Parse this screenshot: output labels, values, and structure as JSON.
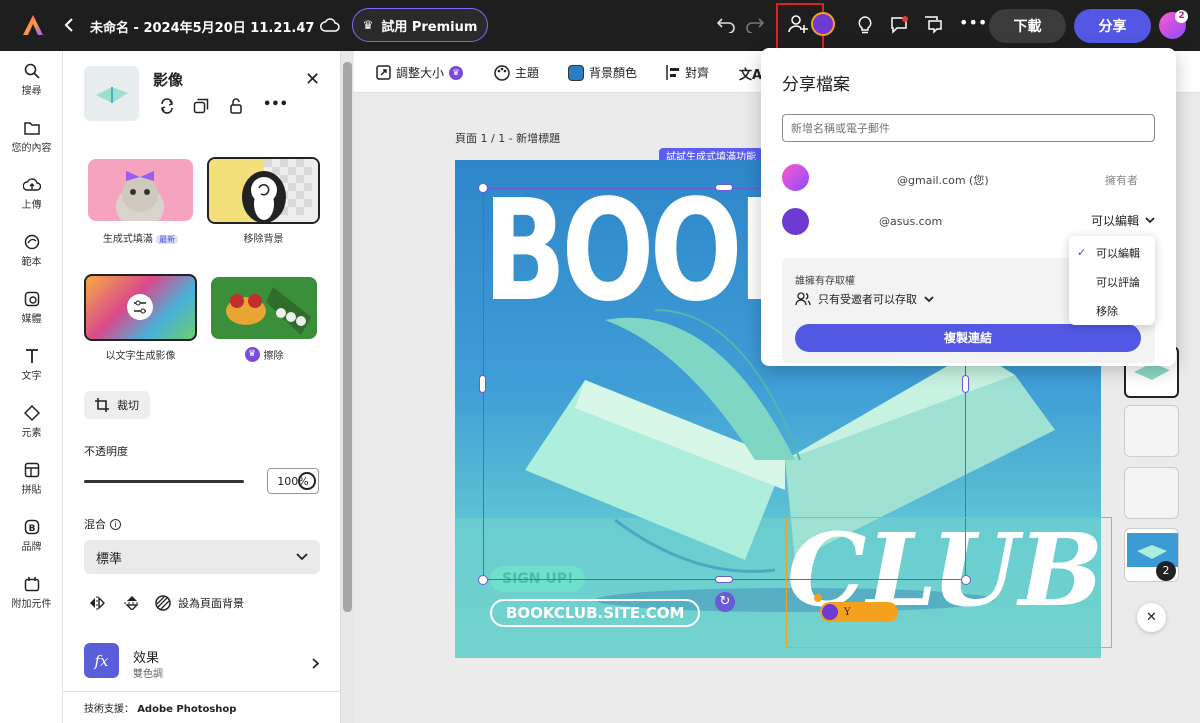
{
  "topbar": {
    "title": "未命名 - 2024年5月20日 11.21.47",
    "premium_label": "試用 Premium",
    "download_label": "下載",
    "share_label": "分享",
    "avatar_badge": "2"
  },
  "rail": {
    "items": [
      {
        "label": "搜尋",
        "icon": "search-icon"
      },
      {
        "label": "您的內容",
        "icon": "folder-icon"
      },
      {
        "label": "上傳",
        "icon": "upload-icon"
      },
      {
        "label": "範本",
        "icon": "template-icon"
      },
      {
        "label": "媒體",
        "icon": "media-icon"
      },
      {
        "label": "文字",
        "icon": "text-icon"
      },
      {
        "label": "元素",
        "icon": "elements-icon"
      },
      {
        "label": "拼貼",
        "icon": "grid-icon"
      },
      {
        "label": "品牌",
        "icon": "brand-icon"
      },
      {
        "label": "附加元件",
        "icon": "addons-icon"
      }
    ]
  },
  "panel": {
    "title": "影像",
    "cards": [
      {
        "label": "生成式填滿",
        "badge": "最新"
      },
      {
        "label": "移除背景"
      },
      {
        "label": "以文字生成影像"
      },
      {
        "label": "擦除"
      }
    ],
    "crop_label": "裁切",
    "opacity_label": "不透明度",
    "opacity_value": "100%",
    "opacity_fraction": 1.0,
    "blend_label": "混合",
    "blend_value": "標準",
    "set_bg_label": "設為頁面背景",
    "effects_title": "效果",
    "effects_sub": "雙色調",
    "footer_prefix": "技術支援：",
    "footer_brand": "Adobe Photoshop"
  },
  "toolbar": {
    "resize": "調整大小",
    "theme": "主題",
    "bg_color": "背景顏色",
    "align": "對齊",
    "bg_color_swatch": "#2a7fc4"
  },
  "canvas": {
    "page_label": "頁面 1 / 1 - 新增標題",
    "gen_fill_tip": "試試生成式填滿功能",
    "poster_title": "BOOK",
    "poster_club": "CLUB",
    "signup": "SIGN UP!",
    "site": "BOOKCLUB.SITE.COM",
    "cursor_label": "Y"
  },
  "share": {
    "title": "分享檔案",
    "input_placeholder": "新增名稱或電子郵件",
    "people": [
      {
        "email": "@gmail.com (您)",
        "role": "擁有者"
      },
      {
        "email": "@asus.com",
        "role": "可以編輯"
      }
    ],
    "access_title": "誰擁有存取權",
    "access_value": "只有受邀者可以存取",
    "copy_link": "複製連結"
  },
  "dropdown": {
    "options": [
      "可以編輯",
      "可以評論",
      "移除"
    ],
    "selected": "可以編輯"
  },
  "pages": {
    "count_badge": "2"
  },
  "colors": {
    "accent": "#5258e4",
    "selection": "#6b5bd6",
    "highlight_red": "#e02020",
    "orange": "#f5a11d"
  }
}
